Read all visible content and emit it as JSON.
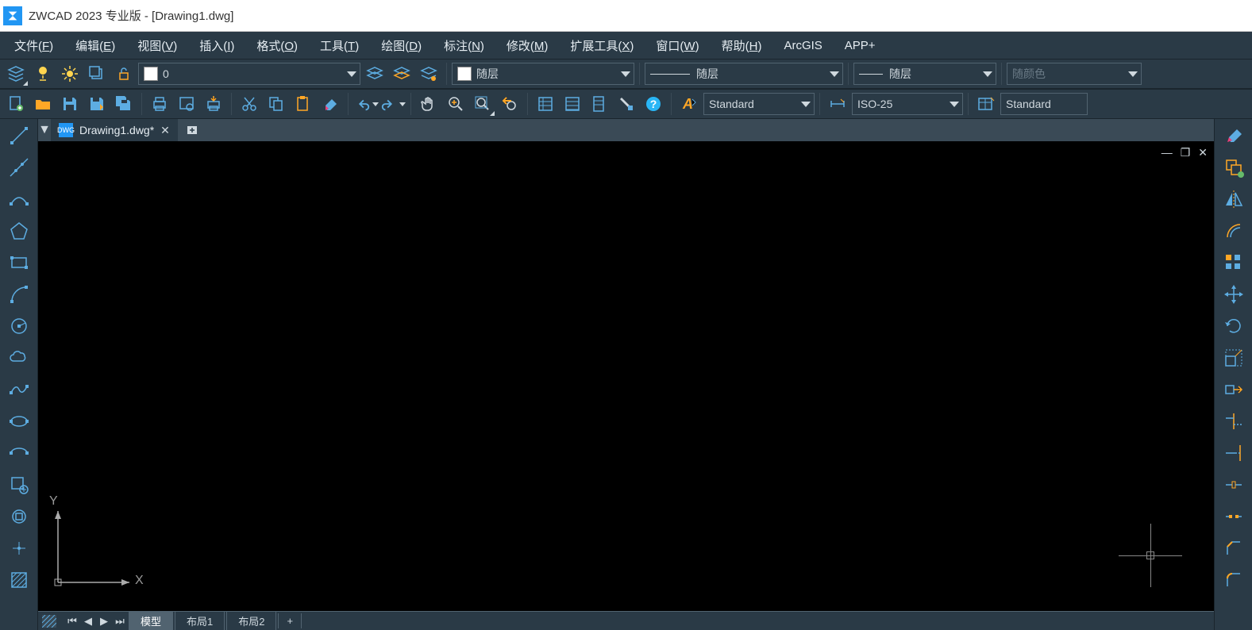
{
  "title": "ZWCAD 2023 专业版 - [Drawing1.dwg]",
  "menus": [
    "文件(F)",
    "编辑(E)",
    "视图(V)",
    "插入(I)",
    "格式(O)",
    "工具(T)",
    "绘图(D)",
    "标注(N)",
    "修改(M)",
    "扩展工具(X)",
    "窗口(W)",
    "帮助(H)",
    "ArcGIS",
    "APP+"
  ],
  "layer_dropdown": "0",
  "color_dropdown": "随层",
  "linetype_dropdown": "随层",
  "lineweight_dropdown": "随层",
  "plotstyle_dropdown": "随颜色",
  "textstyle_dropdown": "Standard",
  "dimstyle_dropdown": "ISO-25",
  "tablestyle_dropdown": "Standard",
  "doc_tab": "Drawing1.dwg*",
  "bottom_tabs": {
    "model": "模型",
    "layout1": "布局1",
    "layout2": "布局2"
  },
  "ucs": {
    "x": "X",
    "y": "Y"
  }
}
